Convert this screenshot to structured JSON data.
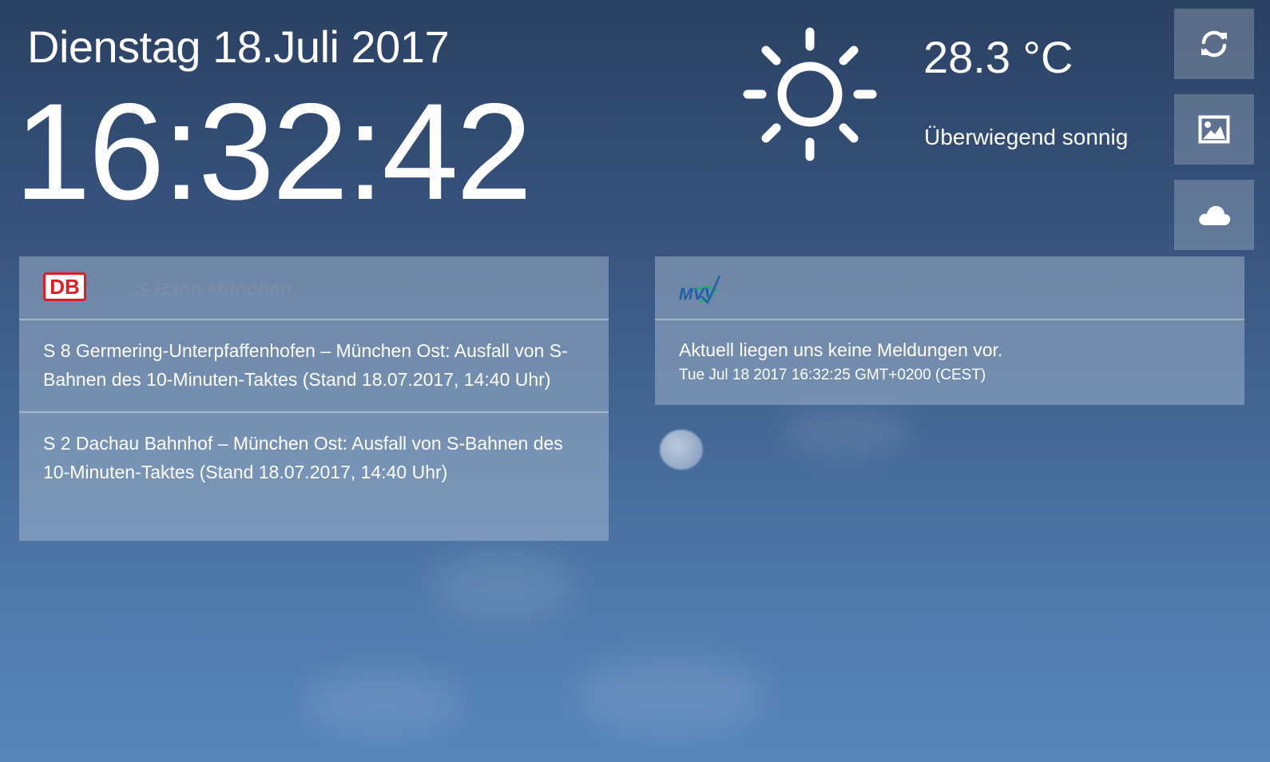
{
  "header": {
    "date": "Dienstag 18.Juli 2017",
    "time": "16:32:42"
  },
  "weather": {
    "icon": "sun-icon",
    "temperature": "28.3 °C",
    "description": "Überwiegend sonnig"
  },
  "sidebar": {
    "buttons": [
      {
        "icon": "refresh-icon"
      },
      {
        "icon": "image-icon"
      },
      {
        "icon": "cloud-icon"
      }
    ]
  },
  "sbahn_panel": {
    "logo_text": "DB",
    "title": "S-Bahn München",
    "messages": [
      "S 8 Germering-Unterpfaffenhofen – München Ost: Ausfall von S-Bahnen des 10-Minuten-Taktes (Stand 18.07.2017, 14:40 Uhr)",
      "S 2 Dachau Bahnhof – München Ost: Ausfall von S-Bahnen des 10-Minuten-Taktes (Stand 18.07.2017, 14:40 Uhr)"
    ]
  },
  "mvv_panel": {
    "logo_text": "MVV",
    "message": "Aktuell liegen uns keine Meldungen vor.",
    "timestamp": "Tue Jul 18 2017 16:32:25 GMT+0200 (CEST)"
  },
  "colors": {
    "db_red": "#e31b23",
    "mvv_blue": "#1f5fa8",
    "mvv_green": "#2aa876"
  }
}
